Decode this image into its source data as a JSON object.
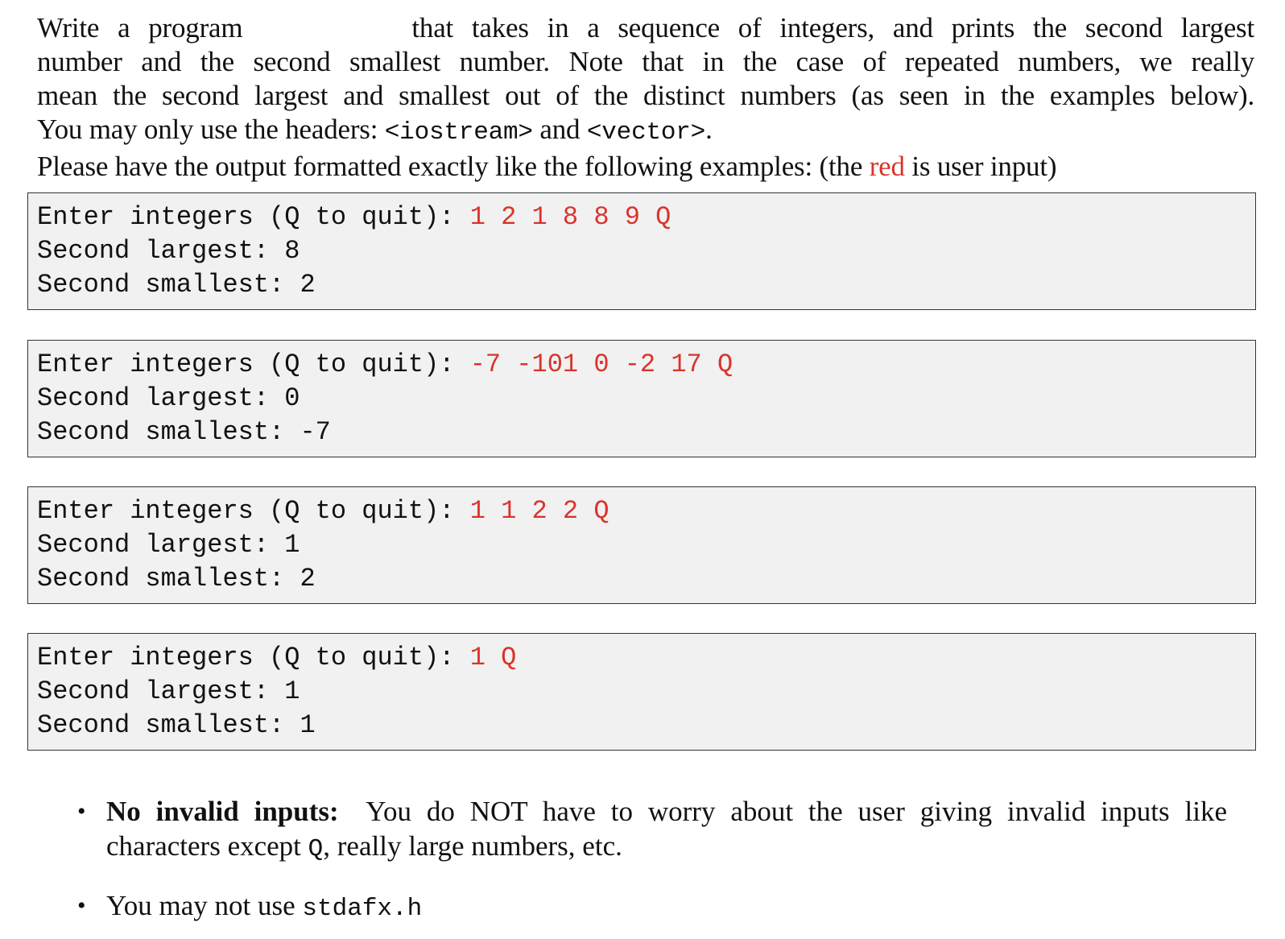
{
  "intro": {
    "line1_start": "Write a program",
    "line1_end": "that takes in a sequence of integers, and prints the second largest",
    "line2": "number and the second smallest number.  Note that in the case of repeated numbers, we really",
    "line3": "mean the second largest and smallest out of the distinct numbers (as seen in the examples below).",
    "line4_start": "You may only use the headers: ",
    "header1": "<iostream>",
    "line4_mid": " and ",
    "header2": "<vector>",
    "line4_end": ".",
    "line5_start": "Please have the output formatted exactly like the following examples: (the ",
    "line5_red": "red",
    "line5_end": " is user input)"
  },
  "colors": {
    "user_input": "#d9342b",
    "box_background": "#f1f1f1",
    "box_border": "#333333"
  },
  "examples": [
    {
      "prompt": "Enter integers (Q to quit): ",
      "input": "1 2 1 8 8 9 Q",
      "largest_label": "Second largest: ",
      "largest_value": "8",
      "smallest_label": "Second smallest: ",
      "smallest_value": "2"
    },
    {
      "prompt": "Enter integers (Q to quit): ",
      "input": "-7 -101 0 -2 17 Q",
      "largest_label": "Second largest: ",
      "largest_value": "0",
      "smallest_label": "Second smallest: ",
      "smallest_value": "-7"
    },
    {
      "prompt": "Enter integers (Q to quit): ",
      "input": "1 1 2 2 Q",
      "largest_label": "Second largest: ",
      "largest_value": "1",
      "smallest_label": "Second smallest: ",
      "smallest_value": "2"
    },
    {
      "prompt": "Enter integers (Q to quit): ",
      "input": "1 Q",
      "largest_label": "Second largest: ",
      "largest_value": "1",
      "smallest_label": "Second smallest: ",
      "smallest_value": "1"
    }
  ],
  "bullets": [
    {
      "bullet_glyph": "•",
      "title": "No invalid inputs:",
      "text_line1": "You do NOT have to worry about the user giving invalid inputs like",
      "text_line2_start": "characters except ",
      "text_line2_code": "Q",
      "text_line2_end": ", really large numbers, etc."
    },
    {
      "bullet_glyph": "•",
      "text_start": "You may not use ",
      "code": "stdafx.h"
    }
  ]
}
